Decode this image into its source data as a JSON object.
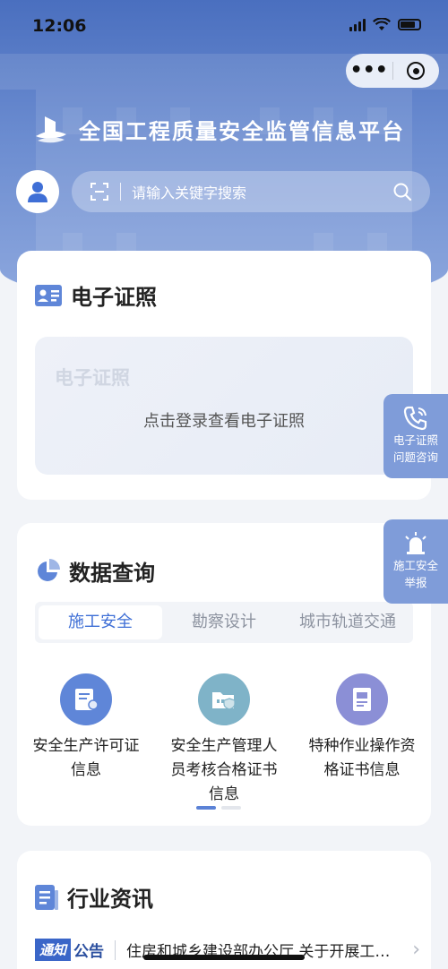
{
  "status_bar": {
    "time": "12:06"
  },
  "capsule": {
    "more_label": "•••"
  },
  "header": {
    "title": "全国工程质量安全监管信息平台"
  },
  "search": {
    "placeholder": "请输入关键字搜索"
  },
  "cert_card": {
    "title": "电子证照",
    "ghost_text": "电子证照",
    "hint": "点击登录查看电子证照"
  },
  "data_card": {
    "title": "数据查询",
    "tabs": [
      {
        "label": "施工安全",
        "active": true
      },
      {
        "label": "勘察设计",
        "active": false
      },
      {
        "label": "城市轨道交通",
        "active": false
      }
    ],
    "items": [
      {
        "label": "安全生产许可证信息",
        "icon": "license-icon",
        "color": "#5f86d8"
      },
      {
        "label": "安全生产管理人员考核合格证书信息",
        "icon": "folder-shield-icon",
        "color": "#7fb3c8"
      },
      {
        "label": "特种作业操作资格证书信息",
        "icon": "document-icon",
        "color": "#8b8fd6"
      }
    ]
  },
  "float_buttons": {
    "cert_help": {
      "label_line1": "电子证照",
      "label_line2": "问题咨询",
      "icon": "phone-icon"
    },
    "report": {
      "label_line1": "施工安全",
      "label_line2": "举报",
      "icon": "alarm-light-icon"
    }
  },
  "news_card": {
    "title": "行业资讯",
    "tag_part1": "通知",
    "tag_part2": "公告",
    "headline": "住房和城乡建设部办公厅 关于开展工程质量安全监管信息平台推广应用的通知"
  },
  "colors": {
    "brand": "#3f6fd6",
    "hero_top": "#4a6fbf",
    "float": "#7f9cd9"
  }
}
